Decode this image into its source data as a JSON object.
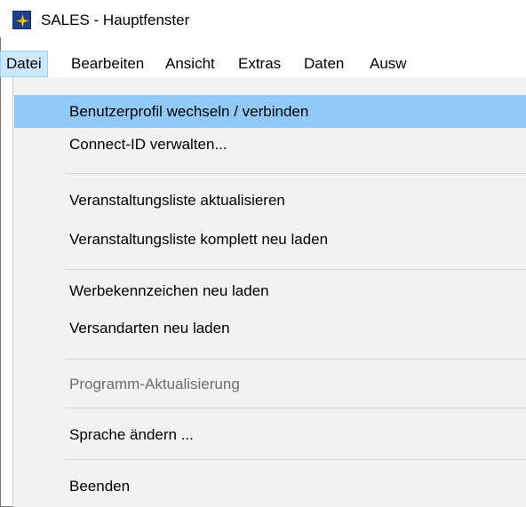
{
  "window": {
    "title": "SALES - Hauptfenster",
    "icon": "sales-star-icon"
  },
  "menubar": {
    "items": [
      {
        "label": "Datei"
      },
      {
        "label": "Bearbeiten"
      },
      {
        "label": "Ansicht"
      },
      {
        "label": "Extras"
      },
      {
        "label": "Daten"
      },
      {
        "label": "Ausw"
      }
    ]
  },
  "dropdown": {
    "items": [
      {
        "label": "Benutzerprofil wechseln / verbinden"
      },
      {
        "label": "Connect-ID verwalten..."
      },
      {
        "label": "Veranstaltungsliste aktualisieren"
      },
      {
        "label": "Veranstaltungsliste komplett neu laden"
      },
      {
        "label": "Werbekennzeichen neu laden"
      },
      {
        "label": "Versandarten neu laden"
      },
      {
        "label": "Programm-Aktualisierung"
      },
      {
        "label": "Sprache ändern ..."
      },
      {
        "label": "Beenden"
      }
    ]
  },
  "colors": {
    "highlight": "#91c9f7",
    "menu_active": "#cce8ff",
    "disabled_text": "#6d6d6d",
    "icon_bg": "#1f3f8f",
    "icon_star": "#f5c400"
  }
}
